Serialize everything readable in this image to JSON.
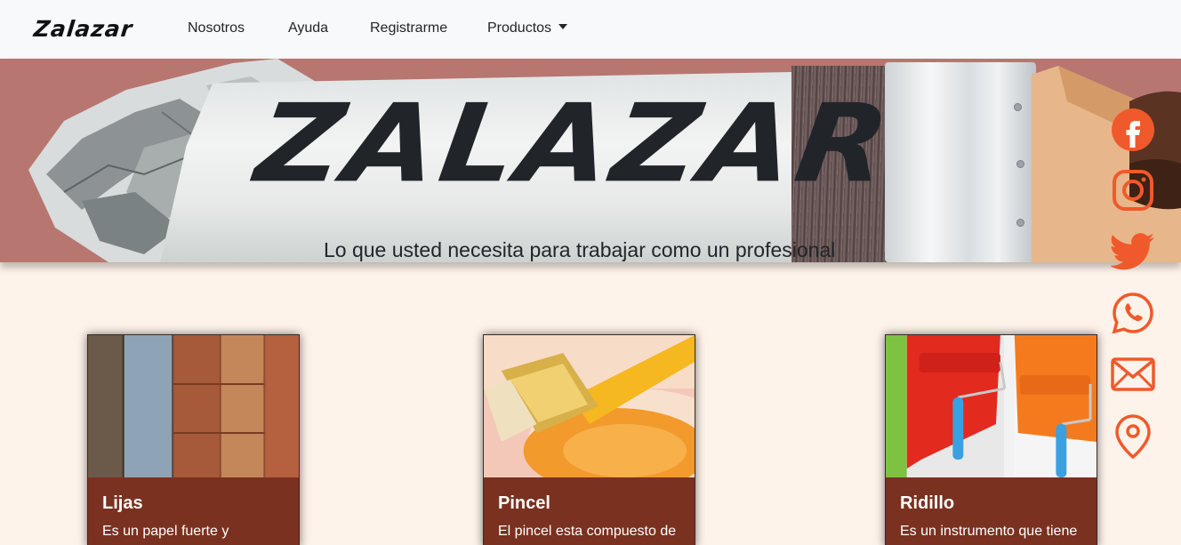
{
  "navbar": {
    "brand": "Zalazar",
    "links": [
      {
        "label": "Nosotros"
      },
      {
        "label": "Ayuda"
      },
      {
        "label": "Registrarme"
      },
      {
        "label": "Productos"
      }
    ]
  },
  "hero": {
    "title": "ZALAZAR",
    "subtitle": "Lo que usted necesita para trabajar como un profesional"
  },
  "social": {
    "icons": [
      "facebook-icon",
      "instagram-icon",
      "twitter-icon",
      "whatsapp-icon",
      "email-icon",
      "location-pin-icon"
    ],
    "color": "#f0592b"
  },
  "cards": [
    {
      "title": "Lijas",
      "text": "Es un papel fuerte y"
    },
    {
      "title": "Pincel",
      "text": "El pincel esta compuesto de"
    },
    {
      "title": "Ridillo",
      "text": "Es un instrumento que tiene"
    }
  ],
  "colors": {
    "page_bg": "#fdf3ea",
    "navbar_bg": "#f8f9fa",
    "hero_bg": "#b87670",
    "card_bg": "#7a3120",
    "accent": "#f0592b"
  }
}
